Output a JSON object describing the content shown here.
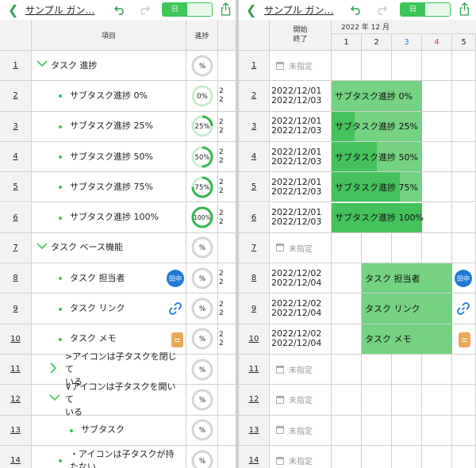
{
  "app": {
    "title": "サンプル ガン…",
    "view_day": "日",
    "view_other": ""
  },
  "left": {
    "headers": {
      "item": "項目",
      "progress": "進捗"
    },
    "rows": [
      {
        "num": "1",
        "level": 0,
        "marker": "chevron-down",
        "label": "タスク 進捗",
        "progress": "%",
        "value": null,
        "clip": ""
      },
      {
        "num": "2",
        "level": 1,
        "marker": "dot",
        "label": "サブタスク進捗 0%",
        "progress": "0%",
        "value": 0.0,
        "clip": "2\n2"
      },
      {
        "num": "3",
        "level": 1,
        "marker": "dot",
        "label": "サブタスク進捗 25%",
        "progress": "25%",
        "value": 0.25,
        "clip": "2\n2"
      },
      {
        "num": "4",
        "level": 1,
        "marker": "dot",
        "label": "サブタスク進捗 50%",
        "progress": "50%",
        "value": 0.5,
        "clip": "2\n2"
      },
      {
        "num": "5",
        "level": 1,
        "marker": "dot",
        "label": "サブタスク進捗 75%",
        "progress": "75%",
        "value": 0.75,
        "clip": "2\n2"
      },
      {
        "num": "6",
        "level": 1,
        "marker": "dot",
        "label": "サブタスク進捗 100%",
        "progress": "100%",
        "value": 1.0,
        "clip": "2\n2"
      },
      {
        "num": "7",
        "level": 0,
        "marker": "chevron-down",
        "label": "タスク ベース機能",
        "progress": "%",
        "value": null,
        "clip": ""
      },
      {
        "num": "8",
        "level": 1,
        "marker": "dot",
        "label": "タスク 担当者",
        "progress": "%",
        "value": null,
        "clip": "2\n2",
        "badge": "avatar"
      },
      {
        "num": "9",
        "level": 1,
        "marker": "dot",
        "label": "タスク リンク",
        "progress": "%",
        "value": null,
        "clip": "2\n2",
        "badge": "link"
      },
      {
        "num": "10",
        "level": 1,
        "marker": "dot",
        "label": "タスク メモ",
        "progress": "%",
        "value": null,
        "clip": "2\n2",
        "badge": "memo"
      },
      {
        "num": "11",
        "level": 1,
        "marker": "chevron-right",
        "label": ">アイコンは子タスクを閉じて\nいる",
        "progress": "%",
        "value": null,
        "clip": ""
      },
      {
        "num": "12",
        "level": 1,
        "marker": "chevron-down",
        "label": "∨アイコンは子タスクを開いて\nいる",
        "progress": "%",
        "value": null,
        "clip": ""
      },
      {
        "num": "13",
        "level": 2,
        "marker": "dot",
        "label": "サブタスク",
        "progress": "%",
        "value": null,
        "clip": ""
      },
      {
        "num": "14",
        "level": 1,
        "marker": "dot",
        "label": "・アイコンは子タスクが持たない",
        "progress": "%",
        "value": null,
        "clip": ""
      }
    ],
    "assignee": "田中"
  },
  "right": {
    "header_dates": "開始\n終了",
    "month": "2022 年 12 月",
    "days": [
      {
        "label": "1",
        "color": "#222222"
      },
      {
        "label": "2",
        "color": "#222222"
      },
      {
        "label": "3",
        "color": "#1d7ad8"
      },
      {
        "label": "4",
        "color": "#e53935"
      },
      {
        "label": "5",
        "color": "#222222"
      }
    ],
    "unset_label": "未指定",
    "rows": [
      {
        "num": "1",
        "start": "",
        "end": ""
      },
      {
        "num": "2",
        "start": "2022/12/01",
        "end": "2022/12/03",
        "bar": "サブタスク進捗 0%",
        "bar_start_day": 1,
        "bar_days": 3,
        "progress": 0.0
      },
      {
        "num": "3",
        "start": "2022/12/01",
        "end": "2022/12/03",
        "bar": "サブタスク進捗 25%",
        "bar_start_day": 1,
        "bar_days": 3,
        "progress": 0.25
      },
      {
        "num": "4",
        "start": "2022/12/01",
        "end": "2022/12/03",
        "bar": "サブタスク進捗 50%",
        "bar_start_day": 1,
        "bar_days": 3,
        "progress": 0.5
      },
      {
        "num": "5",
        "start": "2022/12/01",
        "end": "2022/12/03",
        "bar": "サブタスク進捗 75%",
        "bar_start_day": 1,
        "bar_days": 3,
        "progress": 0.75
      },
      {
        "num": "6",
        "start": "2022/12/01",
        "end": "2022/12/03",
        "bar": "サブタスク進捗 100%",
        "bar_start_day": 1,
        "bar_days": 3,
        "progress": 1.0
      },
      {
        "num": "7",
        "start": "",
        "end": ""
      },
      {
        "num": "8",
        "start": "2022/12/02",
        "end": "2022/12/04",
        "bar": "タスク 担当者",
        "bar_start_day": 2,
        "bar_days": 3,
        "progress": 0.0,
        "badge": "avatar"
      },
      {
        "num": "9",
        "start": "2022/12/02",
        "end": "2022/12/04",
        "bar": "タスク リンク",
        "bar_start_day": 2,
        "bar_days": 3,
        "progress": 0.0,
        "badge": "link"
      },
      {
        "num": "10",
        "start": "2022/12/02",
        "end": "2022/12/04",
        "bar": "タスク メモ",
        "bar_start_day": 2,
        "bar_days": 3,
        "progress": 0.0,
        "badge": "memo"
      },
      {
        "num": "11",
        "start": "",
        "end": ""
      },
      {
        "num": "12",
        "start": "",
        "end": ""
      },
      {
        "num": "13",
        "start": "",
        "end": ""
      },
      {
        "num": "14",
        "start": "",
        "end": ""
      }
    ]
  },
  "colors": {
    "accent": "#3cc65a",
    "bar": "#74d282",
    "bar_fill": "#45c25c",
    "avatar": "#1d7ad8",
    "memo": "#e9a857"
  },
  "icons": [
    "back-chevron-icon",
    "undo-icon",
    "redo-icon",
    "share-icon",
    "calendar-icon",
    "link-icon",
    "memo-icon"
  ]
}
